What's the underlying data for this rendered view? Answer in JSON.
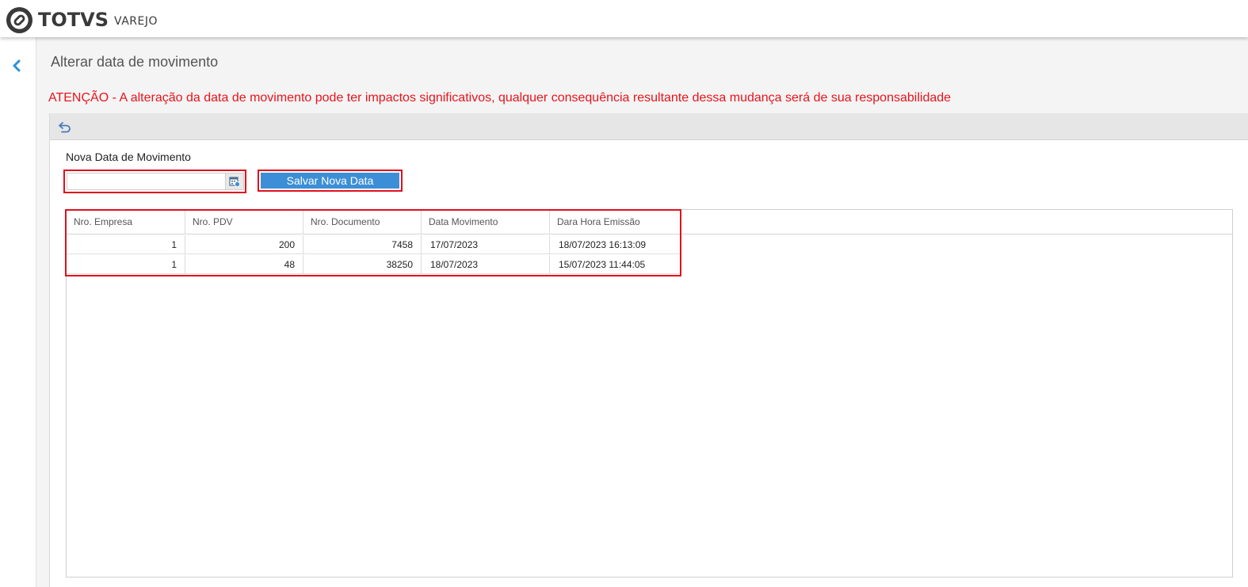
{
  "brand": {
    "name": "TOTVS",
    "module": "VAREJO",
    "accent": "#3c8fd6",
    "warning_color": "#e8141c",
    "highlight_color": "#e0101a"
  },
  "nav": {
    "back_icon": "chevron-left-icon"
  },
  "page": {
    "title": "Alterar data de movimento",
    "warning": "ATENÇÃO - A alteração da data de movimento pode ter impactos significativos, qualquer consequência resultante dessa mudança será de sua responsabilidade"
  },
  "toolbar": {
    "undo_icon": "undo-icon"
  },
  "form": {
    "label": "Nova Data de Movimento",
    "date_value": "",
    "date_placeholder": "",
    "calendar_icon": "calendar-icon",
    "save_label": "Salvar Nova Data"
  },
  "table": {
    "columns": [
      "Nro. Empresa",
      "Nro. PDV",
      "Nro. Documento",
      "Data Movimento",
      "Dara Hora Emissão"
    ],
    "rows": [
      [
        "1",
        "200",
        "7458",
        "17/07/2023",
        "18/07/2023 16:13:09"
      ],
      [
        "1",
        "48",
        "38250",
        "18/07/2023",
        "15/07/2023 11:44:05"
      ]
    ]
  }
}
